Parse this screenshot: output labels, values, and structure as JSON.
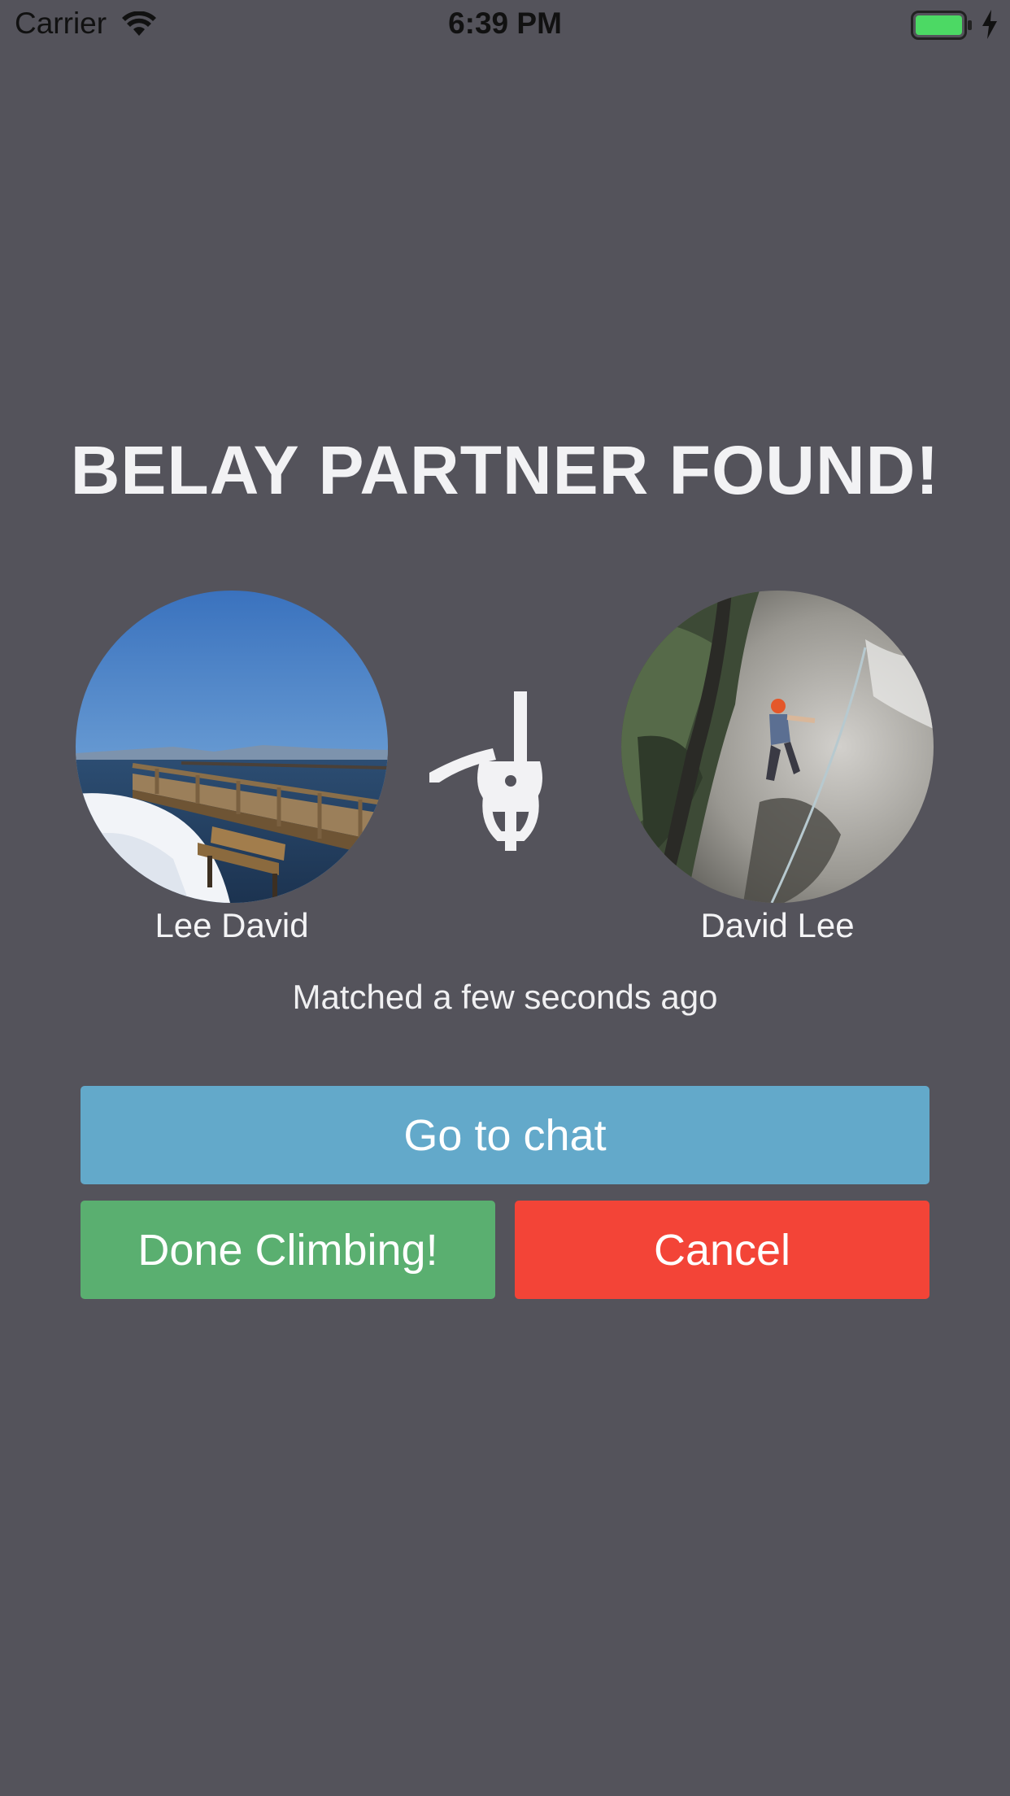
{
  "status_bar": {
    "carrier": "Carrier",
    "time": "6:39 PM",
    "icons": [
      "wifi-icon",
      "battery-icon",
      "charging-icon"
    ],
    "battery_color": "#4cd964"
  },
  "match": {
    "title": "BELAY PARTNER FOUND!",
    "left_user": {
      "name": "Lee David",
      "avatar": "lake-pier-photo"
    },
    "right_user": {
      "name": "David Lee",
      "avatar": "rock-climber-photo"
    },
    "center_icon": "belay-device-icon",
    "matched_text": "Matched a few seconds ago"
  },
  "actions": {
    "chat_label": "Go to chat",
    "done_label": "Done Climbing!",
    "cancel_label": "Cancel"
  },
  "colors": {
    "background": "#54535b",
    "chat_button": "#63a9ca",
    "done_button": "#5aaf70",
    "cancel_button": "#f34437"
  }
}
